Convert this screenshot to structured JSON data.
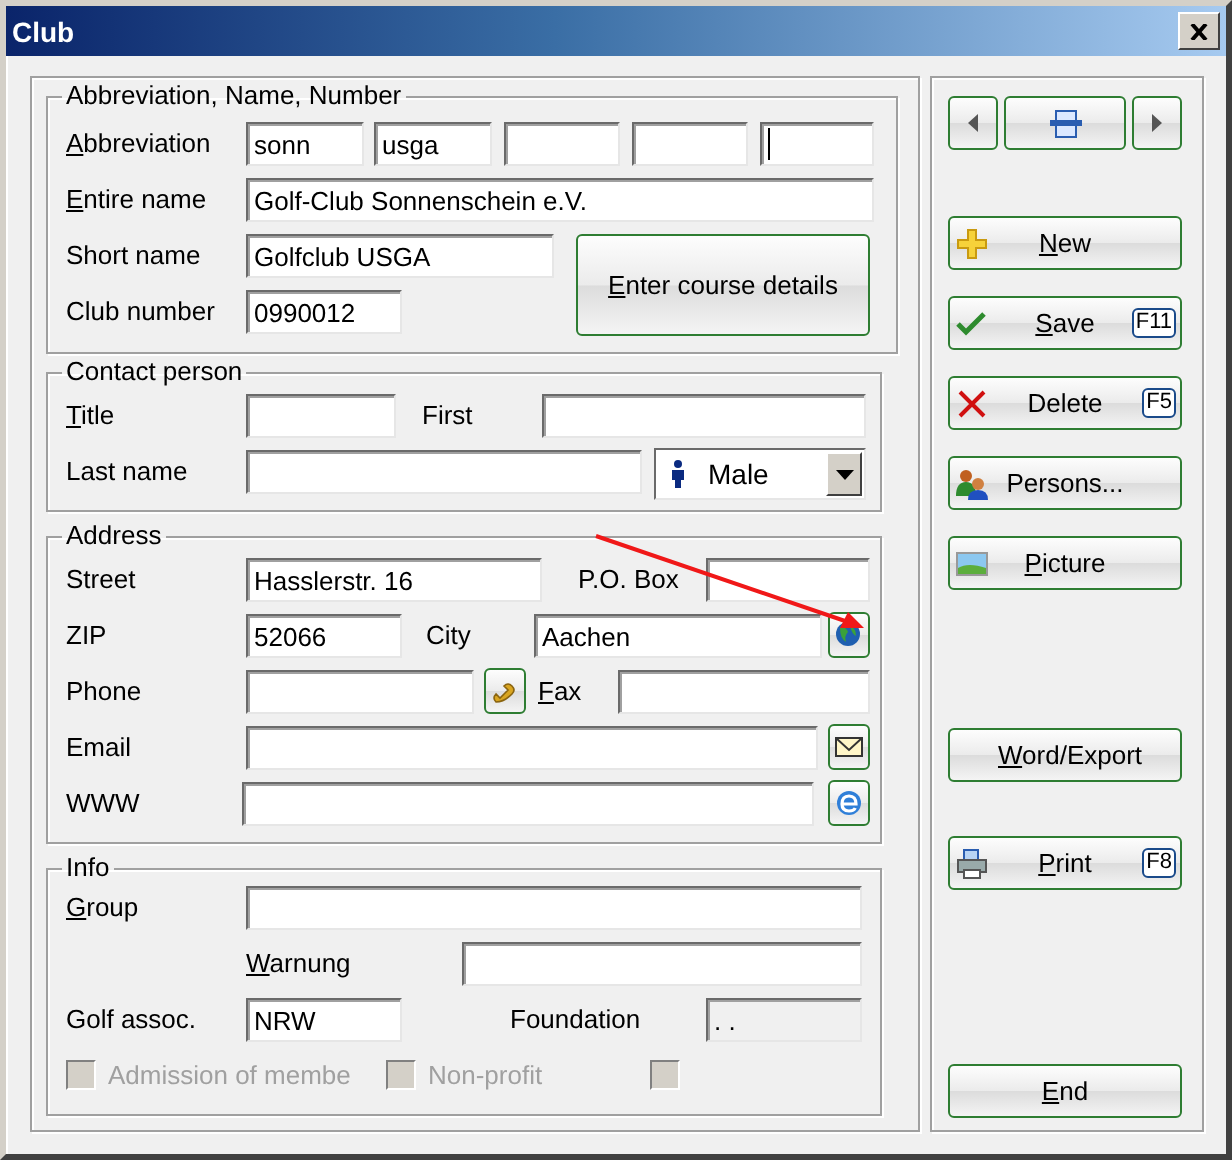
{
  "window": {
    "title": "Club"
  },
  "groups": [
    {
      "title": "Abbreviation, Name, Number",
      "rows": [
        {
          "items": [
            {
              "kind": "label",
              "text": "Abbreviation",
              "underlined_initial": true
            },
            {
              "kind": "field",
              "value": "sonn"
            },
            {
              "kind": "field",
              "value": "usga"
            },
            {
              "kind": "field"
            },
            {
              "kind": "field"
            },
            {
              "kind": "field",
              "focused": true
            }
          ]
        },
        {
          "items": [
            {
              "kind": "label",
              "text": "Entire name",
              "underlined_initial": true
            },
            {
              "kind": "field",
              "value": "Golf-Club Sonnenschein e.V."
            }
          ]
        },
        {
          "items": [
            {
              "kind": "label",
              "text": "Short name",
              "underlined_initial": false
            },
            {
              "kind": "field",
              "value": "Golfclub USGA"
            },
            {
              "kind": "button",
              "text": "Enter course details",
              "underlined_initial": true
            }
          ]
        },
        {
          "items": [
            {
              "kind": "label",
              "text": "Club number",
              "underlined_initial": false
            },
            {
              "kind": "field",
              "value": "0990012"
            }
          ]
        }
      ]
    },
    {
      "title": "Contact person",
      "rows": [
        {
          "items": [
            {
              "kind": "label",
              "text": "Title",
              "underlined_initial": true
            },
            {
              "kind": "field"
            },
            {
              "kind": "label",
              "text": "First",
              "underlined_initial": false
            },
            {
              "kind": "field"
            }
          ]
        },
        {
          "items": [
            {
              "kind": "label",
              "text": "Last name",
              "underlined_initial": false
            },
            {
              "kind": "field"
            },
            {
              "kind": "dropdown",
              "value": "Male"
            }
          ]
        }
      ]
    },
    {
      "title": "Address",
      "rows": [
        {
          "items": [
            {
              "kind": "label",
              "text": "Street",
              "underlined_initial": false
            },
            {
              "kind": "field",
              "value": "Hasslerstr. 16"
            },
            {
              "kind": "label",
              "text": "P.O. Box",
              "underlined_initial": false
            },
            {
              "kind": "field"
            }
          ]
        },
        {
          "items": [
            {
              "kind": "label",
              "text": "ZIP",
              "underlined_initial": false
            },
            {
              "kind": "field",
              "value": "52066"
            },
            {
              "kind": "label",
              "text": "City",
              "underlined_initial": false
            },
            {
              "kind": "field",
              "value": "Aachen"
            },
            {
              "kind": "icon_button"
            }
          ]
        },
        {
          "items": [
            {
              "kind": "label",
              "text": "Phone",
              "underlined_initial": false
            },
            {
              "kind": "field"
            },
            {
              "kind": "icon_button"
            },
            {
              "kind": "label",
              "text": "Fax",
              "underlined_initial": true
            },
            {
              "kind": "field"
            }
          ]
        },
        {
          "items": [
            {
              "kind": "label",
              "text": "Email",
              "underlined_initial": false
            },
            {
              "kind": "field"
            },
            {
              "kind": "icon_button"
            }
          ]
        },
        {
          "items": [
            {
              "kind": "label",
              "text": "WWW",
              "underlined_initial": false
            },
            {
              "kind": "field"
            },
            {
              "kind": "icon_button"
            }
          ]
        }
      ]
    },
    {
      "title": "Info",
      "rows": [
        {
          "items": [
            {
              "kind": "label",
              "text": "Group",
              "underlined_initial": true
            },
            {
              "kind": "field"
            }
          ]
        },
        {
          "items": [
            {
              "kind": "label",
              "text": "Warnung",
              "underlined_initial": true
            },
            {
              "kind": "field"
            }
          ]
        },
        {
          "items": [
            {
              "kind": "label",
              "text": "Golf assoc.",
              "underlined_initial": false
            },
            {
              "kind": "field",
              "value": "NRW"
            },
            {
              "kind": "label",
              "text": "Foundation",
              "underlined_initial": false
            },
            {
              "kind": "field",
              "value": ". .",
              "disabled": true
            }
          ]
        },
        {
          "items": [
            {
              "kind": "checkbox",
              "text": "Admission of membe",
              "checked": false,
              "disabled": true
            },
            {
              "kind": "checkbox",
              "text": "Non-profit",
              "checked": false,
              "disabled": true
            },
            {
              "kind": "checkbox",
              "checked": false,
              "disabled": true
            }
          ]
        }
      ]
    }
  ],
  "side_buttons": [
    {
      "text": "New",
      "underlined_initial": true
    },
    {
      "text": "Save",
      "underlined_initial": true,
      "shortcut": "F11"
    },
    {
      "text": "Delete",
      "underlined_initial": false,
      "shortcut": "F5"
    },
    {
      "text": "Persons...",
      "underlined_initial": false
    },
    {
      "text": "Picture",
      "underlined_initial": true
    },
    {
      "text": "Word/Export",
      "underlined_initial": true
    },
    {
      "text": "Print",
      "underlined_initial": true,
      "shortcut": "F8"
    },
    {
      "text": "End",
      "underlined_initial": true
    }
  ]
}
